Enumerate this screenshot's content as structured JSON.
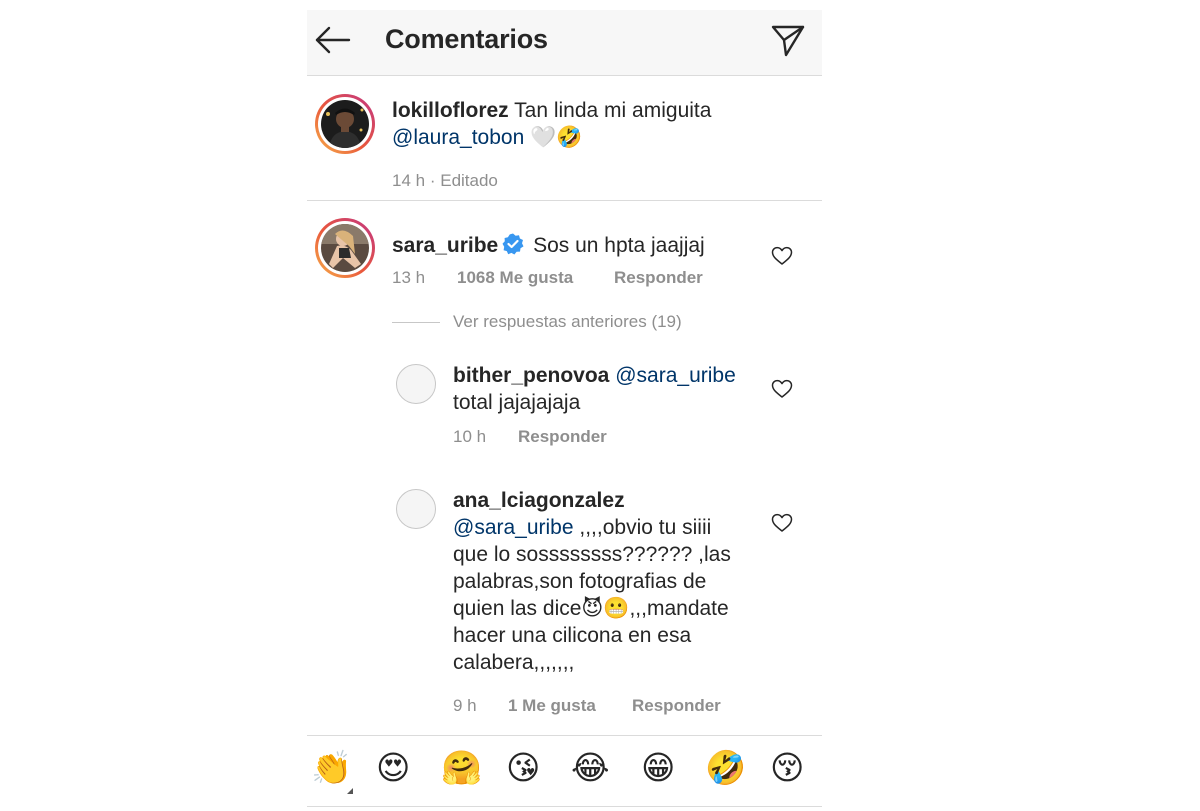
{
  "header": {
    "title": "Comentarios"
  },
  "caption": {
    "username": "lokilloflorez",
    "text": "Tan linda mi amiguita",
    "mention": "@laura_tobon",
    "trailing": "🤍🤣",
    "time": "14 h",
    "separator": "·",
    "edited": "Editado"
  },
  "comments": [
    {
      "username": "sara_uribe",
      "verified": true,
      "text": "Sos un hpta jaajjaj",
      "time": "13 h",
      "likes": "1068 Me gusta",
      "reply": "Responder"
    }
  ],
  "view_previous": "Ver respuestas anteriores (19)",
  "replies": [
    {
      "username": "bither_penovoa",
      "mention": "@sara_uribe",
      "text": "total jajajajaja",
      "time": "10 h",
      "reply": "Responder"
    },
    {
      "username": "ana_lciagonzalez",
      "mention": "@sara_uribe",
      "line1": ",,,,obvio tu siiii",
      "line2": "que lo sossssssss?????? ,las",
      "line3": "palabras,son fotografias de",
      "line4a": "quien las dice",
      "line4_emoji": "😈😬",
      "line4b": ",,,mandate",
      "line5": "hacer una cilicona en esa",
      "line6": "calabera,,,,,,,",
      "time": "9 h",
      "likes": "1 Me gusta",
      "reply": "Responder"
    }
  ],
  "emoji_bar": [
    "👏",
    "😍",
    "🤗",
    "😘",
    "😂",
    "😁",
    "🤣",
    "😚"
  ],
  "colors": {
    "mention": "#003569",
    "meta": "#8e8e8e",
    "verified": "#3897f0",
    "divider": "#dbdbdb"
  },
  "icons": {
    "back": "arrow-left-icon",
    "send": "paper-plane-icon",
    "like": "heart-outline-icon",
    "verified": "verified-badge-icon"
  }
}
